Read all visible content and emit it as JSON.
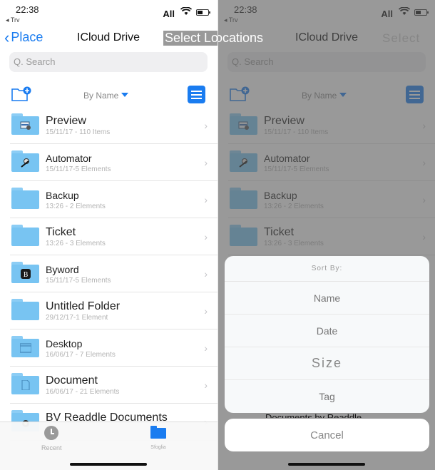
{
  "status": {
    "time": "22:38",
    "back_app": "◂ Trv",
    "signal": "All"
  },
  "navbar": {
    "back_label": "Place",
    "title": "ICloud Drive",
    "right_label": "Select Locations",
    "right_label_dim": "Select",
    "left_label_dim": "ocations",
    "title_dim": "ICloud Drive"
  },
  "search": {
    "placeholder": "Q. Search"
  },
  "toolbar": {
    "sort_label": "By Name",
    "accent": "#1a7cf0"
  },
  "folders": [
    {
      "name": "Preview",
      "meta": "15/11/17 - 110 Items",
      "icon": "preview-app-icon"
    },
    {
      "name": "Automator",
      "meta": "15/11/17-5 Elements",
      "icon": "automator-app-icon"
    },
    {
      "name": "Backup",
      "meta": "13:26 - 2 Elements",
      "icon": ""
    },
    {
      "name": "Ticket",
      "meta": "13:26 - 3 Elements",
      "icon": ""
    },
    {
      "name": "Byword",
      "meta": "15/11/17-5 Elements",
      "icon": "byword-app-icon"
    },
    {
      "name": "Untitled Folder",
      "meta": "29/12/17-1 Element",
      "icon": ""
    },
    {
      "name": "Desktop",
      "meta": "16/06/17 - 7 Elements",
      "icon": "window-icon"
    },
    {
      "name": "Document",
      "meta": "16/06/17 - 21 Elements",
      "icon": "document-icon"
    },
    {
      "name": "BV Readdle Documents",
      "meta": "",
      "icon": "readdle-app-icon"
    }
  ],
  "tabbar": {
    "recent": "Recent",
    "browse": "Sfoglia"
  },
  "sort_sheet": {
    "title": "Sort By:",
    "options": [
      "Name",
      "Date",
      "Size",
      "Tag"
    ],
    "cancel": "Cancel",
    "behind_text": "Documents by Readdle"
  }
}
